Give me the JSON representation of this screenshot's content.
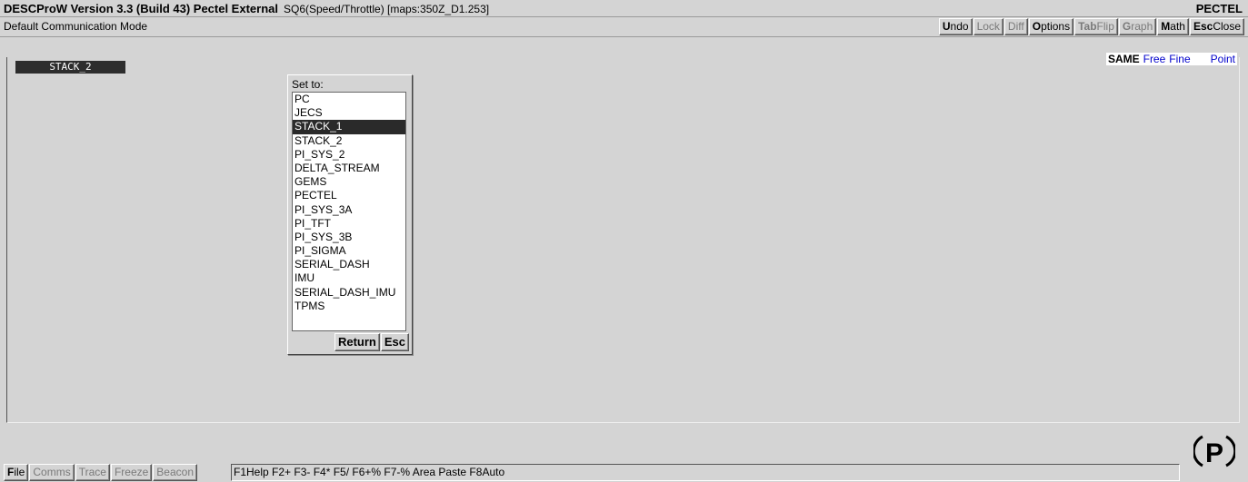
{
  "titlebar": {
    "title": "DESCProW Version 3.3 (Build 43) Pectel External",
    "subtitle": "SQ6(Speed/Throttle) [maps:350Z_D1.253]",
    "brand": "PECTEL"
  },
  "modebar": {
    "mode_label": "Default Communication Mode",
    "buttons": [
      "Undo",
      "Lock",
      "Diff",
      "Options",
      "TabFlip",
      "Graph",
      "Math",
      "EscClose"
    ]
  },
  "edit_modes": {
    "same": "SAME",
    "free": "Free",
    "fine": "Fine",
    "point": "Point"
  },
  "current_value": "STACK_2",
  "popup": {
    "header": "Set to:",
    "options": [
      "PC",
      "JECS",
      "STACK_1",
      "STACK_2",
      "PI_SYS_2",
      "DELTA_STREAM",
      "GEMS",
      "PECTEL",
      "PI_SYS_3A",
      "PI_TFT",
      "PI_SYS_3B",
      "PI_SIGMA",
      "SERIAL_DASH",
      "IMU",
      "SERIAL_DASH_IMU",
      "TPMS"
    ],
    "selected": "STACK_1",
    "return_label": "Return",
    "esc_label": "Esc"
  },
  "bottombar": {
    "tabs": [
      "File",
      "Comms",
      "Trace",
      "Freeze",
      "Beacon"
    ],
    "keys_text": "F1Help F2+ F3- F4* F5/ F6+% F7-% Area Paste F8Auto"
  },
  "colors": {
    "selection": "#2a2a2a",
    "link_blue": "#0000cc",
    "background": "#d4d4d4"
  },
  "logo": "P"
}
